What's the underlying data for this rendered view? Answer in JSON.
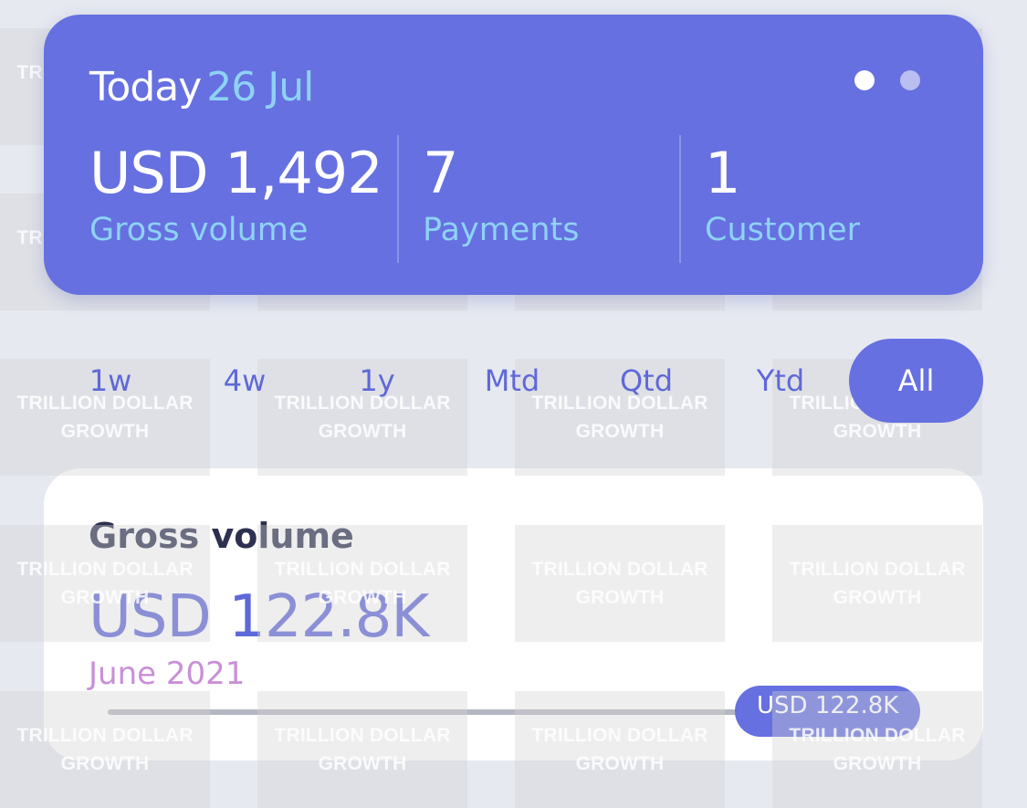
{
  "summary": {
    "today_label": "Today",
    "date": "26 Jul",
    "stats": [
      {
        "value": "USD 1,492",
        "label": "Gross volume"
      },
      {
        "value": "7",
        "label": "Payments"
      },
      {
        "value": "1",
        "label": "Customer"
      }
    ],
    "pages": {
      "count": 2,
      "active": 1
    }
  },
  "periods": {
    "options": [
      "1w",
      "4w",
      "1y",
      "Mtd",
      "Qtd",
      "Ytd",
      "All"
    ],
    "selected": "All"
  },
  "volume_card": {
    "title": "Gross volume",
    "amount": "USD 122.8K",
    "period": "June 2021",
    "badge": "USD 122.8K"
  },
  "watermark": {
    "line1": "TRILLION DOLLAR",
    "line2": "GROWTH"
  },
  "colors": {
    "accent": "#6670e0",
    "date_highlight": "#8ed2f6",
    "period_text": "#5f68d8",
    "volume_period": "#c98fd8"
  }
}
